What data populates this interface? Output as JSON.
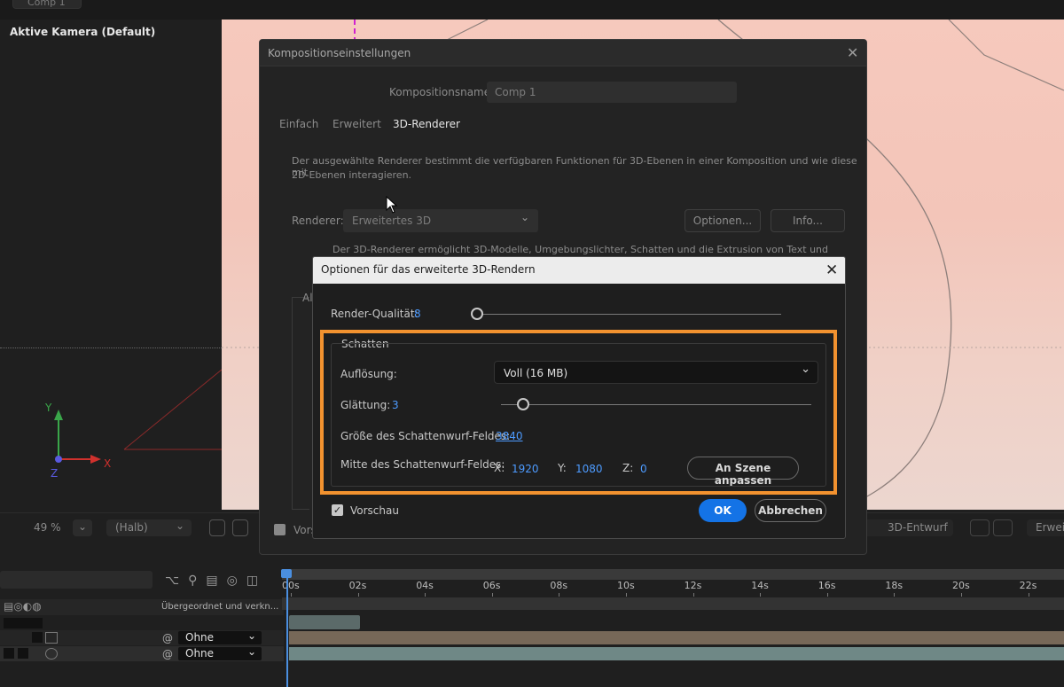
{
  "top_tab": "Comp 1",
  "left_panel": {
    "title": "Aktive Kamera (Default)"
  },
  "axes": {
    "y": "Y",
    "x": "X",
    "z": "Z"
  },
  "viewer_bar": {
    "zoom": "49 %",
    "resolution": "(Halb)",
    "renderer_mode": "3D-Entwurf",
    "extended": "Erweit"
  },
  "timeline": {
    "ruler": [
      "00s",
      "02s",
      "04s",
      "06s",
      "08s",
      "10s",
      "12s",
      "14s",
      "16s",
      "18s",
      "20s",
      "22s"
    ],
    "parent_header": "Übergeordnet und verkn...",
    "rows": [
      {
        "parent": "Ohne"
      },
      {
        "parent": "Ohne"
      }
    ]
  },
  "comp_dialog": {
    "title": "Kompositionseinstellungen",
    "name_label": "Kompositionsname:",
    "name_value": "Comp 1",
    "tabs": [
      "Einfach",
      "Erweitert",
      "3D-Renderer"
    ],
    "active_tab": "3D-Renderer",
    "description_line1": "Der ausgewählte Renderer bestimmt die verfügbaren Funktionen für 3D-Ebenen in einer Komposition und wie diese mit",
    "description_line2": "2D-Ebenen interagieren.",
    "renderer_label": "Renderer:",
    "renderer_value": "Erweitertes 3D",
    "options_button": "Optionen...",
    "info_button": "Info...",
    "renderer_note": "Der 3D-Renderer ermöglicht 3D-Modelle, Umgebungslichter, Schatten und die Extrusion von Text und Formen.",
    "group_partial": "Al",
    "preview_partial": "Vors"
  },
  "options_dialog": {
    "title": "Optionen für das erweiterte 3D-Rendern",
    "render_quality_label": "Render-Qualität:",
    "render_quality_value": "8",
    "shadow_group": "Schatten",
    "resolution_label": "Auflösung:",
    "resolution_value": "Voll (16 MB)",
    "smoothing_label": "Glättung:",
    "smoothing_value": "3",
    "field_size_label": "Größe des Schattenwurf-Feldes:",
    "field_size_value": "3840",
    "field_center_label": "Mitte des Schattenwurf-Feldes:",
    "x_label": "X:",
    "x_value": "1920",
    "y_label": "Y:",
    "y_value": "1080",
    "z_label": "Z:",
    "z_value": "0",
    "fit_scene_button": "An Szene anpassen",
    "preview_label": "Vorschau",
    "preview_checked": true,
    "ok_button": "OK",
    "cancel_button": "Abbrechen",
    "render_quality_fraction": 0.0,
    "smoothing_fraction": 0.07
  },
  "colors": {
    "accent_blue": "#1473e6",
    "highlight_orange": "#f2922f",
    "value_blue": "#4d9bff"
  }
}
